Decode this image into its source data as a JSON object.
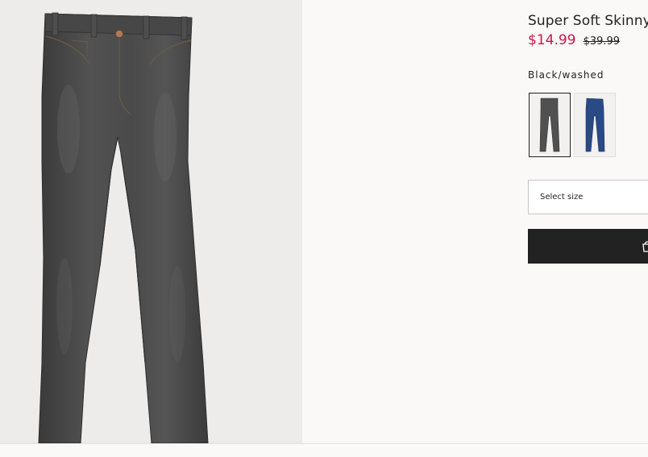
{
  "product": {
    "title": "Super Soft Skinny",
    "price_sale": "$14.99",
    "price_original": "$39.99",
    "selected_color": "Black/washed",
    "colors": [
      "Black/washed",
      "Dark denim blue"
    ]
  },
  "size": {
    "label": "Select size"
  },
  "cart": {
    "icon": "shopping-bag-icon"
  },
  "theme": {
    "sale_price_color": "#d01345",
    "button_color": "#222222",
    "page_background": "#faf9f8"
  }
}
